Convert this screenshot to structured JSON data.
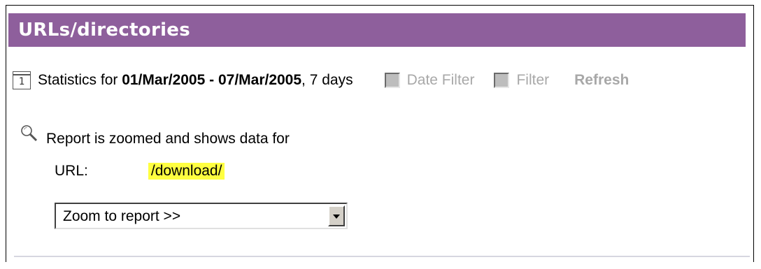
{
  "header": {
    "title": "URLs/directories"
  },
  "stats": {
    "calendar_icon_digit": "1",
    "prefix": "Statistics for ",
    "date_range": "01/Mar/2005 - 07/Mar/2005",
    "suffix": ", 7 days"
  },
  "filters": {
    "date_filter_label": "Date Filter",
    "filter_label": "Filter",
    "refresh_label": "Refresh"
  },
  "zoom": {
    "message": "Report is zoomed and shows data for",
    "url_label": "URL:",
    "url_value": "/download/",
    "select_value": "Zoom to report >>"
  },
  "colors": {
    "header_bg": "#8e5f9c",
    "highlight": "#ffff40",
    "disabled_text": "#a8a8a8"
  }
}
